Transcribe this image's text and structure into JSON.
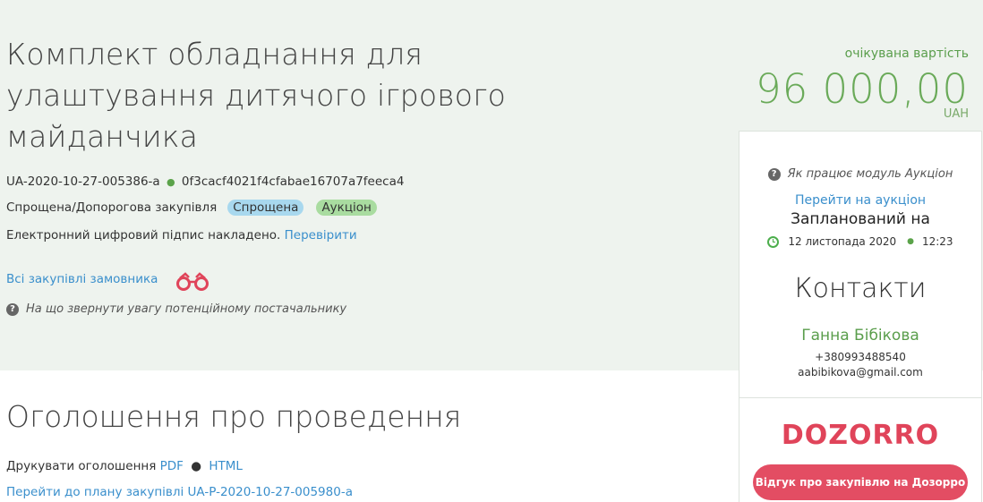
{
  "tender": {
    "title": "Комплект обладнання для улаштування дитячого ігрового майданчика",
    "id": "UA-2020-10-27-005386-a",
    "hash": "0f3cacf4021f4cfabae16707a7feeca4",
    "procurement_type": "Спрощена/Допорогова закупівля",
    "badges": [
      "Спрощена",
      "Аукціон"
    ],
    "signature_text": "Електронний цифровий підпис накладено.",
    "signature_link": "Перевірити",
    "all_purchases_link": "Всі закупівлі замовника",
    "hint": "На що звернути увагу потенційному постачальнику"
  },
  "expected": {
    "label": "очікувана вартість",
    "amount": "96 000,00",
    "currency": "UAH"
  },
  "sidebar": {
    "auction_hint": "Як працює модуль Аукціон",
    "auction_link": "Перейти на аукціон",
    "scheduled_label": "Запланований на",
    "scheduled_date": "12 листопада 2020",
    "scheduled_time": "12:23",
    "contacts_title": "Контакти",
    "contact_name": "Ганна Бібікова",
    "contact_phone": "+380993488540",
    "contact_email": "aabibikova@gmail.com",
    "dozorro_logo": "DOZORRO",
    "dozorro_button": "Відгук про закупівлю на Дозорро"
  },
  "announcement": {
    "title": "Оголошення про проведення",
    "print_label": "Друкувати оголошення",
    "pdf_link": "PDF",
    "html_link": "HTML",
    "plan_link": "Перейти до плану закупівлі UA-P-2020-10-27-005980-a"
  },
  "colors": {
    "hero_bg": "#eef3ee",
    "link": "#3a8fcc",
    "green": "#6aaa59",
    "dozorro": "#e34d63"
  }
}
